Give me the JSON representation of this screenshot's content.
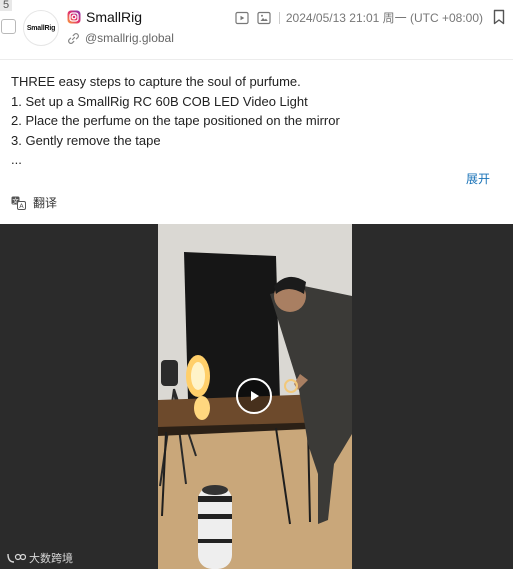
{
  "post": {
    "index": "5",
    "account": {
      "name": "SmallRig",
      "handle": "@smallrig.global",
      "avatar_text": "SmallRig",
      "platform_icon": "instagram-icon"
    },
    "meta": {
      "icons": [
        "video-icon",
        "image-icon"
      ],
      "timestamp": "2024/05/13 21:01 周一 (UTC +08:00)"
    },
    "content": {
      "lines": [
        "THREE easy steps to capture the soul of purfume.",
        "",
        "1. Set up a SmallRig RC 60B COB LED Video Light",
        "2. Place the perfume on the tape positioned on the mirror",
        "3. Gently remove the tape",
        "..."
      ],
      "expand_label": "展开"
    },
    "translate_label": "翻译",
    "media": {
      "type": "video",
      "play_icon": "play-icon",
      "watermark": "大数跨境"
    }
  },
  "colors": {
    "link": "#1a73b8",
    "instagram": "#d6249f",
    "media_background": "#2b2b2b"
  }
}
